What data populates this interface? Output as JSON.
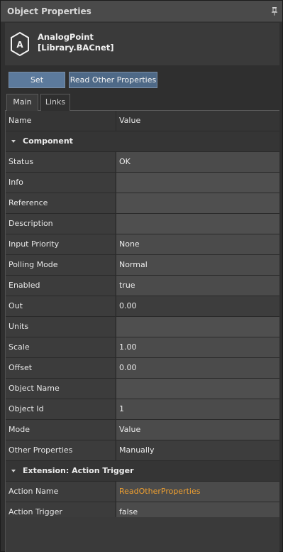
{
  "panel": {
    "title": "Object Properties",
    "pin_icon": "pin-icon"
  },
  "object": {
    "icon": "analog-point-icon",
    "icon_letter": "A",
    "name_line1": "AnalogPoint",
    "name_line2": "[Library.BACnet]"
  },
  "buttons": {
    "set_label": "Set",
    "read_other_label": "Read Other Properties"
  },
  "tabs": {
    "main": "Main",
    "links": "Links"
  },
  "grid": {
    "col_name": "Name",
    "col_value": "Value",
    "section_component": "Component",
    "section_extension": "Extension: Action Trigger",
    "component_rows": [
      {
        "name": "Status",
        "value": "OK"
      },
      {
        "name": "Info",
        "value": ""
      },
      {
        "name": "Reference",
        "value": ""
      },
      {
        "name": "Description",
        "value": ""
      },
      {
        "name": "Input Priority",
        "value": "None"
      },
      {
        "name": "Polling Mode",
        "value": "Normal"
      },
      {
        "name": "Enabled",
        "value": "true"
      },
      {
        "name": "Out",
        "value": "0.00"
      },
      {
        "name": "Units",
        "value": ""
      },
      {
        "name": "Scale",
        "value": "1.00"
      },
      {
        "name": "Offset",
        "value": "0.00"
      },
      {
        "name": "Object Name",
        "value": ""
      },
      {
        "name": "Object Id",
        "value": "1"
      },
      {
        "name": "Mode",
        "value": "Value"
      },
      {
        "name": "Other Properties",
        "value": "Manually"
      }
    ],
    "extension_rows": [
      {
        "name": "Action Name",
        "value": "ReadOtherProperties"
      },
      {
        "name": "Action Trigger",
        "value": "false"
      }
    ]
  },
  "colors": {
    "accent_button": "#5c7a9c",
    "highlight_text": "#f0a030"
  }
}
